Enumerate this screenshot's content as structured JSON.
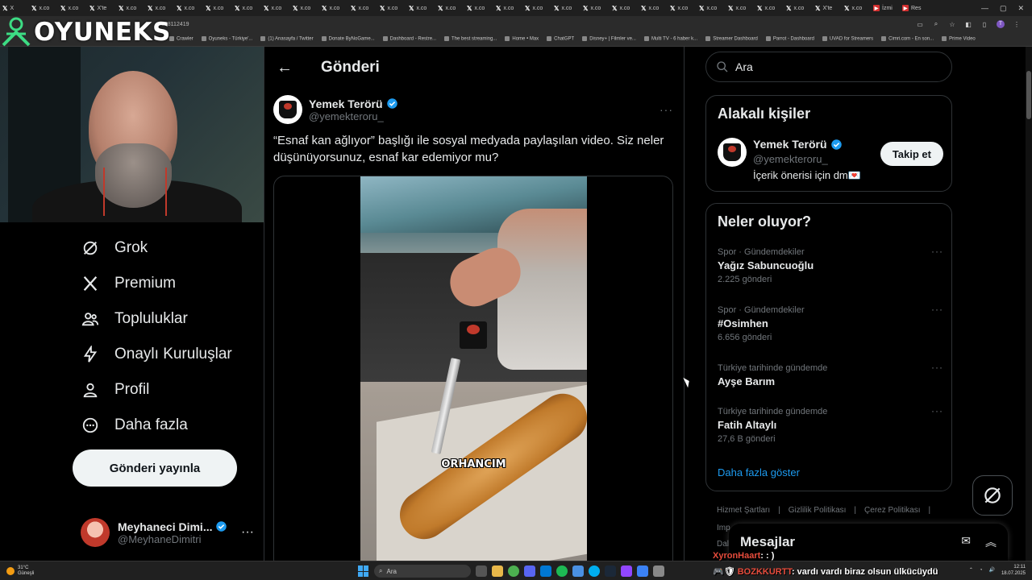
{
  "browser": {
    "tabs": [
      {
        "label": "X",
        "kind": "x"
      },
      {
        "label": "x.co",
        "kind": "x"
      },
      {
        "label": "x.co",
        "kind": "x"
      },
      {
        "label": "X'te",
        "kind": "x"
      },
      {
        "label": "x.co",
        "kind": "x"
      },
      {
        "label": "x.co",
        "kind": "x"
      },
      {
        "label": "x.co",
        "kind": "x"
      },
      {
        "label": "x.co",
        "kind": "x"
      },
      {
        "label": "x.co",
        "kind": "x"
      },
      {
        "label": "x.co",
        "kind": "x"
      },
      {
        "label": "x.co",
        "kind": "x"
      },
      {
        "label": "x.co",
        "kind": "x"
      },
      {
        "label": "x.co",
        "kind": "x"
      },
      {
        "label": "x.co",
        "kind": "x"
      },
      {
        "label": "x.co",
        "kind": "x"
      },
      {
        "label": "x.co",
        "kind": "x"
      },
      {
        "label": "x.co",
        "kind": "x"
      },
      {
        "label": "x.co",
        "kind": "x"
      },
      {
        "label": "x.co",
        "kind": "x"
      },
      {
        "label": "x.co",
        "kind": "x"
      },
      {
        "label": "x.co",
        "kind": "x"
      },
      {
        "label": "x.co",
        "kind": "x"
      },
      {
        "label": "x.co",
        "kind": "x"
      },
      {
        "label": "x.co",
        "kind": "x"
      },
      {
        "label": "x.co",
        "kind": "x"
      },
      {
        "label": "x.co",
        "kind": "x"
      },
      {
        "label": "x.co",
        "kind": "x"
      },
      {
        "label": "x.co",
        "kind": "x"
      },
      {
        "label": "X'te",
        "kind": "x"
      },
      {
        "label": "x.co",
        "kind": "x"
      },
      {
        "label": "İzmi",
        "kind": "red"
      },
      {
        "label": "Res",
        "kind": "red"
      }
    ],
    "address": "888112419",
    "bookmarks": [
      "Crawler",
      "Oyuneks - Türkiye'...",
      "(1) Anasayfa / Twitter",
      "Donate ByNoGame...",
      "Dashboard - Restre...",
      "The best streaming...",
      "Home • Max",
      "ChatGPT",
      "Disney+ | Filmler ve...",
      "Multi TV - 6 haber k...",
      "Streamer Dashboard",
      "Parrot - Dashboard",
      "UVAD for Streamers",
      "Cimri.com - En son...",
      "Prime Video"
    ]
  },
  "brand": {
    "name": "OYUNEKS"
  },
  "nav": {
    "items": [
      {
        "label": "Grok",
        "icon": "grok-icon"
      },
      {
        "label": "Premium",
        "icon": "x-logo-icon"
      },
      {
        "label": "Topluluklar",
        "icon": "communities-icon"
      },
      {
        "label": "Onaylı Kuruluşlar",
        "icon": "lightning-icon"
      },
      {
        "label": "Profil",
        "icon": "profile-icon"
      },
      {
        "label": "Daha fazla",
        "icon": "more-circle-icon"
      }
    ],
    "post_button": "Gönderi yayınla",
    "account": {
      "name": "Meyhaneci Dimi...",
      "handle": "@MeyhaneDimitri"
    }
  },
  "main": {
    "header_title": "Gönderi",
    "tweet": {
      "author_name": "Yemek Terörü",
      "author_handle": "@yemekteroru_",
      "text": "“Esnaf kan ağlıyor” başlığı ile sosyal medyada paylaşılan video. Siz neler düşünüyorsunuz, esnaf kar edemiyor mu?",
      "video_caption": "ORHANCIM"
    }
  },
  "right": {
    "search_placeholder": "Ara",
    "related": {
      "title": "Alakalı kişiler",
      "name": "Yemek Terörü",
      "handle": "@yemekteroru_",
      "bio": "İçerik önerisi için dm💌",
      "follow_label": "Takip et"
    },
    "trends": {
      "title": "Neler oluyor?",
      "items": [
        {
          "context": "Spor · Gündemdekiler",
          "title": "Yağız Sabuncuoğlu",
          "count": "2.225 gönderi"
        },
        {
          "context": "Spor · Gündemdekiler",
          "title": "#Osimhen",
          "count": "6.656 gönderi"
        },
        {
          "context": "Türkiye tarihinde gündemde",
          "title": "Ayşe Barım",
          "count": ""
        },
        {
          "context": "Türkiye tarihinde gündemde",
          "title": "Fatih Altaylı",
          "count": "27,6 B gönderi"
        }
      ],
      "show_more": "Daha fazla göster"
    },
    "footer": {
      "links": [
        "Hizmet Şartları",
        "Gizlilik Politikası",
        "Çerez Politikası"
      ],
      "line2": "Imp",
      "line3": "Dal"
    },
    "messages_title": "Mesajlar"
  },
  "chat": {
    "line1_user": "XyronHaart",
    "line1_text": ": : )",
    "line2_user": "BOZKKURTT",
    "line2_text": ": vardı vardı biraz olsun ülkücüydü"
  },
  "taskbar": {
    "weather_temp": "31°C",
    "weather_desc": "Güneşli",
    "search_label": "Ara",
    "time": "12:11",
    "date": "18.07.2025"
  },
  "colors": {
    "accent": "#1d9bf0",
    "background": "#000000",
    "border": "#2f3336"
  }
}
